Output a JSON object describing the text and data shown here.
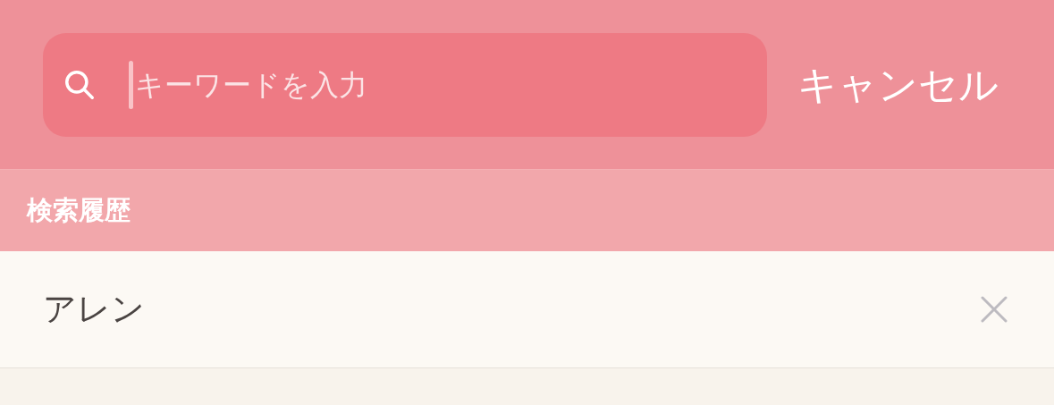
{
  "search": {
    "placeholder": "キーワードを入力",
    "focused": true
  },
  "cancel_button": "キャンセル",
  "section_header": "検索履歴",
  "history": [
    {
      "text": "アレン"
    }
  ]
}
